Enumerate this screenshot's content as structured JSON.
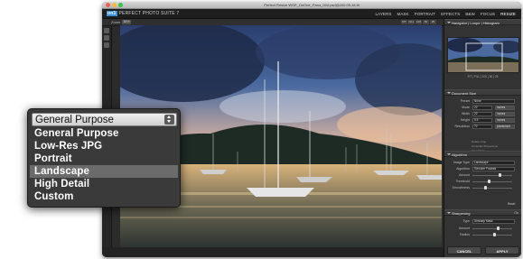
{
  "window": {
    "title": "Perfect Resize WSP_OnOne_Pano_004.psd@200.05.18.tif",
    "traffic_colors": [
      "#ee5f57",
      "#f6be2f",
      "#39c443"
    ]
  },
  "brand": {
    "logo": "on1",
    "name": "PERFECT PHOTO SUITE 7"
  },
  "modes": [
    "LAYERS",
    "MASK",
    "PORTRAIT",
    "EFFECTS",
    "B&W",
    "FOCUS",
    "RESIZE"
  ],
  "active_mode": "RESIZE",
  "toolbar": {
    "zoom_label": "Zoom",
    "zoom_value": "34%",
    "zoom_buttons": [
      "FIT",
      "FILL",
      "100",
      "50",
      "25"
    ]
  },
  "panel": {
    "navigator": {
      "tabs": "Navigator | Loupe | Histogram",
      "info": "FIT | FILL | 100 | 50 | 25"
    },
    "document_size": {
      "header": "Document Size",
      "preset_label": "Preset",
      "preset_value": "None",
      "mode_label": "Mode",
      "mode_value": "22",
      "mode_unit": "inches",
      "width_label": "Width",
      "width_value": "22",
      "width_unit": "inches",
      "height_label": "Height",
      "height_value": "5.5",
      "height_unit": "inches",
      "resolution_label": "Resolution",
      "resolution_value": "72",
      "resolution_unit": "pixels/inch",
      "checks": [
        "Rotate Crop",
        "Constrain Proportions",
        "Crop Mode"
      ],
      "reset": "Reset"
    },
    "algorithm": {
      "header": "Algorithm",
      "image_type_label": "Image Type",
      "image_type_value": "Landscape",
      "algorithm_label": "Algorithm",
      "algorithm_value": "Genuine Fractals",
      "amount_label": "Amount",
      "threshold_label": "Threshold",
      "smoothness_label": "Smoothness",
      "reset": "Reset"
    },
    "sharpening": {
      "header": "Sharpening",
      "state": "On",
      "type_label": "Type",
      "type_value": "Unsharp Mask",
      "amount_label": "Amount",
      "radius_label": "Radius"
    },
    "cancel_label": "CANCEL",
    "apply_label": "APPLY"
  },
  "popup": {
    "selected": "General Purpose",
    "options": [
      "General Purpose",
      "Low-Res JPG",
      "Portrait",
      "Landscape",
      "High Detail",
      "Custom"
    ],
    "highlighted": "Landscape"
  }
}
